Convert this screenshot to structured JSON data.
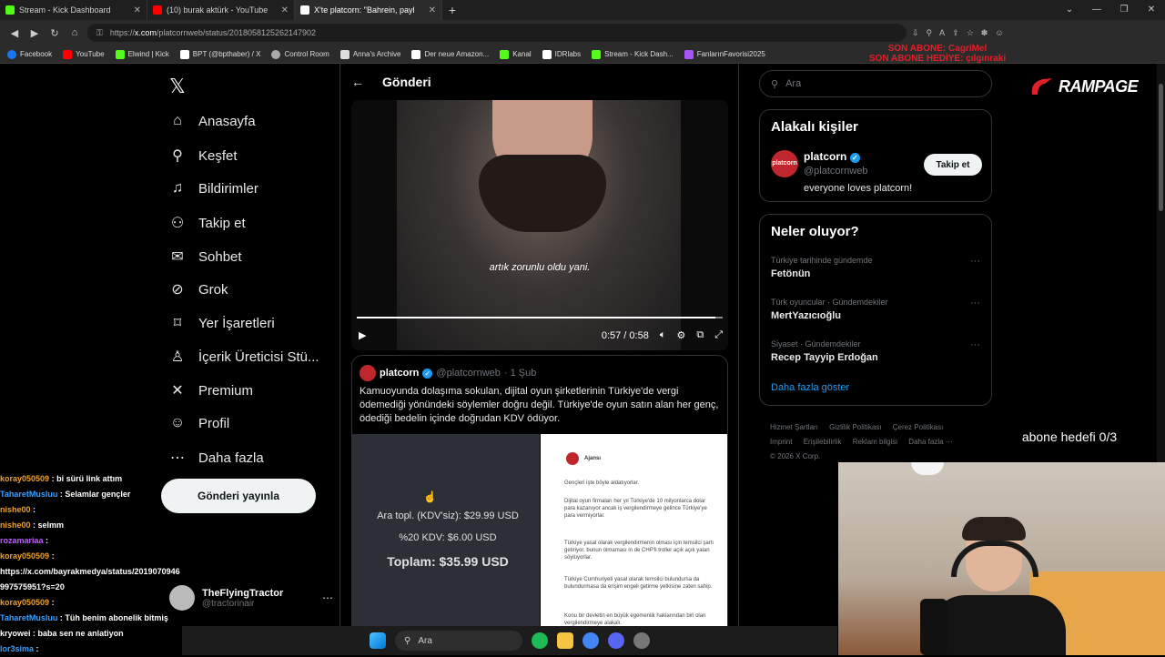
{
  "browser": {
    "tabs": [
      {
        "title": "Stream - Kick Dashboard",
        "icon": "kick-icon",
        "color": "#53fc18"
      },
      {
        "title": "(10) burak aktürk - YouTube",
        "icon": "youtube-icon",
        "color": "#ff0000"
      },
      {
        "title": "X'te platcorn: \"Bahrein, payla",
        "icon": "x-icon",
        "color": "#ffffff"
      }
    ],
    "url_prefix": "https://",
    "url_host": "x.com",
    "url_path": "/platcornweb/status/2018058125262147902",
    "bookmarks": [
      {
        "label": "Facebook",
        "icon": "facebook-icon",
        "color": "#1877f2"
      },
      {
        "label": "YouTube",
        "icon": "youtube-icon",
        "color": "#ff0000"
      },
      {
        "label": "Elwind | Kick",
        "icon": "kick-icon",
        "color": "#53fc18"
      },
      {
        "label": "BPT (@bpthaber) / X",
        "icon": "x-icon",
        "color": "#ffffff"
      },
      {
        "label": "Control Room",
        "icon": "gear-icon",
        "color": "#aaaaaa"
      },
      {
        "label": "Anna's Archive",
        "icon": "archive-icon",
        "color": "#dddddd"
      },
      {
        "label": "Der neue Amazon...",
        "icon": "amazon-icon",
        "color": "#ffffff"
      },
      {
        "label": "Kanal",
        "icon": "kick-icon",
        "color": "#53fc18"
      },
      {
        "label": "IDRlabs",
        "icon": "idrlabs-icon",
        "color": "#ffffff"
      },
      {
        "label": "Stream - Kick Dash...",
        "icon": "kick-icon",
        "color": "#53fc18"
      },
      {
        "label": "FanlarınFavorisi2025",
        "icon": "fanlar-icon",
        "color": "#a855f7"
      }
    ]
  },
  "overlay": {
    "line1": "SON ABONE: CagriMel",
    "line2": "SON ABONE HEDİYE: çılgınraki",
    "brand": "RAMPAGE",
    "goal": "abone hedefi 0/3"
  },
  "nav": {
    "items": [
      {
        "label": "Anasayfa",
        "icon": "home-icon",
        "glyph": "⌂"
      },
      {
        "label": "Keşfet",
        "icon": "search-icon",
        "glyph": "⚲"
      },
      {
        "label": "Bildirimler",
        "icon": "bell-icon",
        "glyph": "♫"
      },
      {
        "label": "Takip et",
        "icon": "add-user-icon",
        "glyph": "⚇"
      },
      {
        "label": "Sohbet",
        "icon": "mail-icon",
        "glyph": "✉"
      },
      {
        "label": "Grok",
        "icon": "grok-icon",
        "glyph": "⊘"
      },
      {
        "label": "Yer İşaretleri",
        "icon": "bookmark-icon",
        "glyph": "⌑"
      },
      {
        "label": "İçerik Üreticisi Stü...",
        "icon": "creator-studio-icon",
        "glyph": "♙"
      },
      {
        "label": "Premium",
        "icon": "x-icon",
        "glyph": "✕"
      },
      {
        "label": "Profil",
        "icon": "profile-icon",
        "glyph": "☺"
      },
      {
        "label": "Daha fazla",
        "icon": "more-icon",
        "glyph": "⋯"
      }
    ],
    "post_button": "Gönderi yayınla",
    "account_name": "TheFlyingTractor",
    "account_handle": "@tractorinair"
  },
  "main": {
    "header_title": "Gönderi",
    "video": {
      "subtitle": "artık zorunlu oldu yani.",
      "time": "0:57 / 0:58",
      "progress": 0.98
    },
    "quote": {
      "name": "platcorn",
      "handle": "@platcornweb",
      "date": "· 1 Şub",
      "text": "Kamuoyunda dolaşıma sokulan, dijital oyun şirketlerinin Türkiye'de vergi ödemediği yönündeki söylemler doğru değil. Türkiye'de oyun satın alan her genç, ödediği bedelin içinde doğrudan KDV ödüyor.",
      "img1_line1": "Ara topl. (KDV'siz): $29.99 USD",
      "img1_line2": "%20 KDV: $6.00 USD",
      "img1_line3": "Toplam: $35.99 USD",
      "img2_title": "Ajansı",
      "img2_p1": "Gençleri işte böyle aldatıyorlar.",
      "img2_p2": "Dijital oyun firmaları her yıl Türkiye'de 10 milyonlarca dolar para kazanıyor ancak iş vergilendirmeye gelince Türkiye'ye para vermiyorlar.",
      "img2_p3": "Türkiye yasal olarak vergilendirmenin olması için temsilci şartı getiriyor, bunun olmaması in de CHP'li troller açık açık yalan söylüyorlar.",
      "img2_p4": "Türkiye Cumhuriyeti yasal olarak temsilci bulundursa da bulundurmasa da erişim engeli getirme yetkisine zaten sahip.",
      "img2_p5": "Konu bir devletin en büyük egemenlik haklarından biri olan vergilendirmeye alakalı."
    }
  },
  "right": {
    "search_placeholder": "Ara",
    "related_title": "Alakalı kişiler",
    "person": {
      "name": "platcorn",
      "handle": "@platcornweb",
      "bio": "everyone loves platcorn!",
      "follow": "Takip et",
      "avatar_text": "platcorn"
    },
    "trends_title": "Neler oluyor?",
    "trends": [
      {
        "category": "Türkiye tarihinde gündemde",
        "title": "Fetönün"
      },
      {
        "category": "Türk oyuncular · Gündemdekiler",
        "title": "MertYazıcıoğlu"
      },
      {
        "category": "Siyaset · Gündemdekiler",
        "title": "Recep Tayyip Erdoğan"
      }
    ],
    "show_more": "Daha fazla göster",
    "footer": [
      "Hizmet Şartları",
      "Gizlilik Politikası",
      "Çerez Politikası",
      "Imprint",
      "Erişilebilirlik",
      "Reklam bilgisi",
      "Daha fazla ···",
      "© 2026 X Corp."
    ]
  },
  "chat": [
    {
      "user": "koray050509",
      "text": ": bi sürü link attım",
      "color": "#f0a020"
    },
    {
      "user": "TaharetMusluu",
      "text": ": Selamlar gençler",
      "color": "#3aa0ff"
    },
    {
      "user": "nishe00",
      "text": ":",
      "color": "#f0a020"
    },
    {
      "user": "nishe00",
      "text": ": selmm",
      "color": "#f0a020"
    },
    {
      "user": "rozamariaa",
      "text": ":",
      "color": "#c060ff"
    },
    {
      "user": "koray050509",
      "text": ":",
      "color": "#f0a020"
    },
    {
      "user": "",
      "text": "https://x.com/bayrakmedya/status/2019070946997575951?s=20",
      "color": "#ffffff"
    },
    {
      "user": "koray050509",
      "text": ":",
      "color": "#f0a020"
    },
    {
      "user": "TaharetMusluu",
      "text": ": Tüh benim abonelik bitmiş",
      "color": "#3aa0ff"
    },
    {
      "user": "kryowei",
      "text": ": baba sen ne anlatiyon",
      "color": "#ffffff"
    },
    {
      "user": "lor3sima",
      "text": ":",
      "color": "#3aa0ff"
    }
  ],
  "taskbar": {
    "search": "Ara"
  }
}
